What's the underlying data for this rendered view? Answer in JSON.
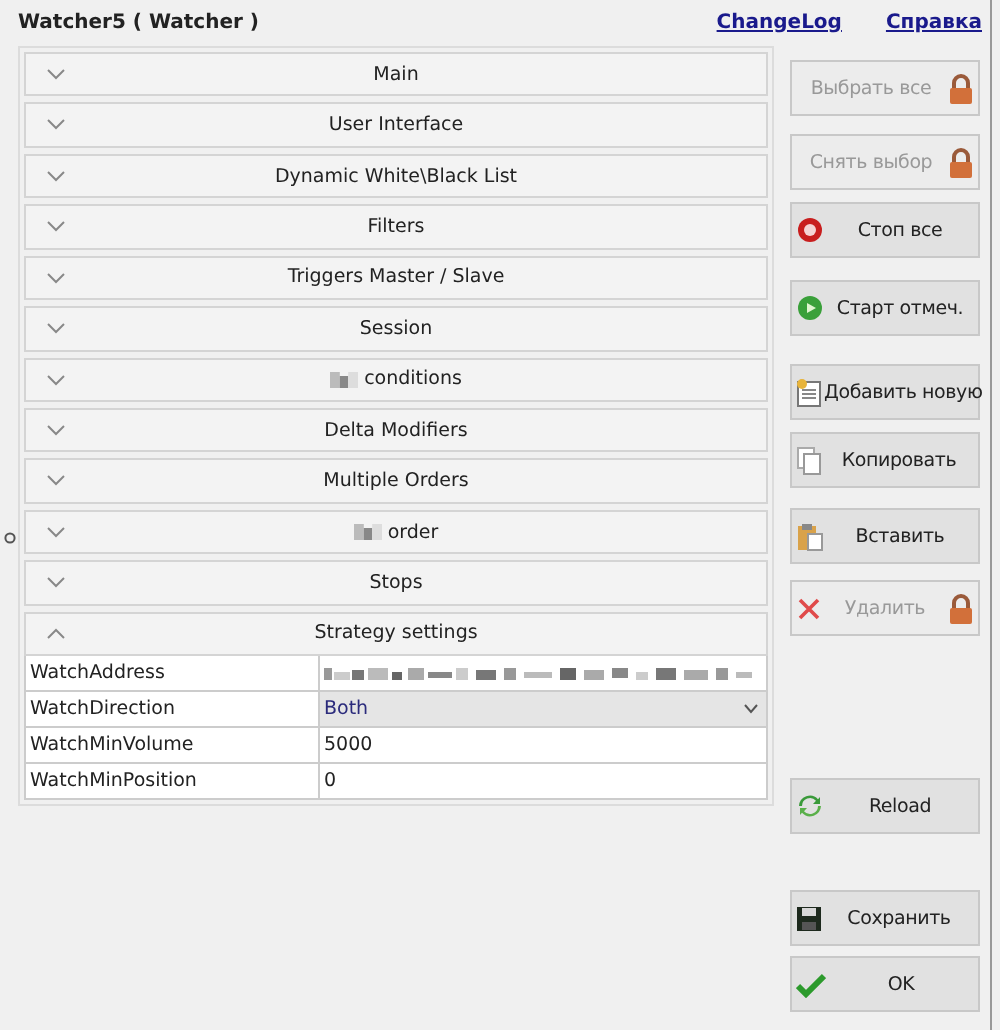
{
  "window": {
    "title": "Watcher5  ( Watcher )",
    "links": [
      "ChangeLog",
      "Справка"
    ]
  },
  "sections": [
    {
      "label": "Main",
      "expanded": false
    },
    {
      "label": "User Interface",
      "expanded": false
    },
    {
      "label": "Dynamic White\\Black List",
      "expanded": false
    },
    {
      "label": "Filters",
      "expanded": false
    },
    {
      "label": "Triggers  Master / Slave",
      "expanded": false
    },
    {
      "label": "Session",
      "expanded": false
    },
    {
      "label": "conditions",
      "expanded": false,
      "redacted": true
    },
    {
      "label": "Delta Modifiers",
      "expanded": false
    },
    {
      "label": "Multiple Orders",
      "expanded": false
    },
    {
      "label": "order",
      "expanded": false,
      "redacted": true
    },
    {
      "label": "Stops",
      "expanded": false
    },
    {
      "label": "Strategy settings",
      "expanded": true
    }
  ],
  "properties": [
    {
      "name": "WatchAddress",
      "kind": "redacted"
    },
    {
      "name": "WatchDirection",
      "kind": "dropdown",
      "value": "Both"
    },
    {
      "name": "WatchMinVolume",
      "kind": "text",
      "value": "5000"
    },
    {
      "name": "WatchMinPosition",
      "kind": "text",
      "value": "0"
    }
  ],
  "buttons": [
    {
      "label": "Выбрать все",
      "kind": "lock",
      "disabled": true
    },
    {
      "label": "Снять выбор",
      "kind": "lock",
      "disabled": true
    },
    {
      "label": "Стоп все",
      "kind": "stop",
      "disabled": false
    },
    {
      "label": "Старт отмеч.",
      "kind": "start",
      "disabled": false
    },
    {
      "label": "Добавить новую",
      "kind": "add",
      "disabled": false
    },
    {
      "label": "Копировать",
      "kind": "copy",
      "disabled": false
    },
    {
      "label": "Вставить",
      "kind": "paste",
      "disabled": false
    },
    {
      "label": "Удалить",
      "kind": "delete",
      "disabled": true
    }
  ],
  "bottom_buttons": [
    {
      "label": "Reload",
      "kind": "reload"
    },
    {
      "label": "Сохранить",
      "kind": "save"
    },
    {
      "label": "OK",
      "kind": "ok"
    }
  ]
}
